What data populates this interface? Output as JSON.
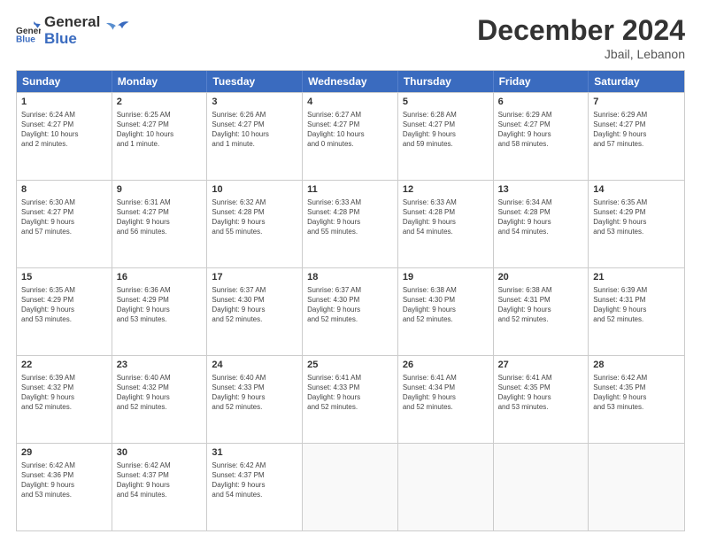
{
  "app": {
    "logo_line1": "General",
    "logo_line2": "Blue",
    "month": "December 2024",
    "location": "Jbail, Lebanon"
  },
  "header_days": [
    "Sunday",
    "Monday",
    "Tuesday",
    "Wednesday",
    "Thursday",
    "Friday",
    "Saturday"
  ],
  "rows": [
    [
      {
        "day": "1",
        "text": "Sunrise: 6:24 AM\nSunset: 4:27 PM\nDaylight: 10 hours\nand 2 minutes."
      },
      {
        "day": "2",
        "text": "Sunrise: 6:25 AM\nSunset: 4:27 PM\nDaylight: 10 hours\nand 1 minute."
      },
      {
        "day": "3",
        "text": "Sunrise: 6:26 AM\nSunset: 4:27 PM\nDaylight: 10 hours\nand 1 minute."
      },
      {
        "day": "4",
        "text": "Sunrise: 6:27 AM\nSunset: 4:27 PM\nDaylight: 10 hours\nand 0 minutes."
      },
      {
        "day": "5",
        "text": "Sunrise: 6:28 AM\nSunset: 4:27 PM\nDaylight: 9 hours\nand 59 minutes."
      },
      {
        "day": "6",
        "text": "Sunrise: 6:29 AM\nSunset: 4:27 PM\nDaylight: 9 hours\nand 58 minutes."
      },
      {
        "day": "7",
        "text": "Sunrise: 6:29 AM\nSunset: 4:27 PM\nDaylight: 9 hours\nand 57 minutes."
      }
    ],
    [
      {
        "day": "8",
        "text": "Sunrise: 6:30 AM\nSunset: 4:27 PM\nDaylight: 9 hours\nand 57 minutes."
      },
      {
        "day": "9",
        "text": "Sunrise: 6:31 AM\nSunset: 4:27 PM\nDaylight: 9 hours\nand 56 minutes."
      },
      {
        "day": "10",
        "text": "Sunrise: 6:32 AM\nSunset: 4:28 PM\nDaylight: 9 hours\nand 55 minutes."
      },
      {
        "day": "11",
        "text": "Sunrise: 6:33 AM\nSunset: 4:28 PM\nDaylight: 9 hours\nand 55 minutes."
      },
      {
        "day": "12",
        "text": "Sunrise: 6:33 AM\nSunset: 4:28 PM\nDaylight: 9 hours\nand 54 minutes."
      },
      {
        "day": "13",
        "text": "Sunrise: 6:34 AM\nSunset: 4:28 PM\nDaylight: 9 hours\nand 54 minutes."
      },
      {
        "day": "14",
        "text": "Sunrise: 6:35 AM\nSunset: 4:29 PM\nDaylight: 9 hours\nand 53 minutes."
      }
    ],
    [
      {
        "day": "15",
        "text": "Sunrise: 6:35 AM\nSunset: 4:29 PM\nDaylight: 9 hours\nand 53 minutes."
      },
      {
        "day": "16",
        "text": "Sunrise: 6:36 AM\nSunset: 4:29 PM\nDaylight: 9 hours\nand 53 minutes."
      },
      {
        "day": "17",
        "text": "Sunrise: 6:37 AM\nSunset: 4:30 PM\nDaylight: 9 hours\nand 52 minutes."
      },
      {
        "day": "18",
        "text": "Sunrise: 6:37 AM\nSunset: 4:30 PM\nDaylight: 9 hours\nand 52 minutes."
      },
      {
        "day": "19",
        "text": "Sunrise: 6:38 AM\nSunset: 4:30 PM\nDaylight: 9 hours\nand 52 minutes."
      },
      {
        "day": "20",
        "text": "Sunrise: 6:38 AM\nSunset: 4:31 PM\nDaylight: 9 hours\nand 52 minutes."
      },
      {
        "day": "21",
        "text": "Sunrise: 6:39 AM\nSunset: 4:31 PM\nDaylight: 9 hours\nand 52 minutes."
      }
    ],
    [
      {
        "day": "22",
        "text": "Sunrise: 6:39 AM\nSunset: 4:32 PM\nDaylight: 9 hours\nand 52 minutes."
      },
      {
        "day": "23",
        "text": "Sunrise: 6:40 AM\nSunset: 4:32 PM\nDaylight: 9 hours\nand 52 minutes."
      },
      {
        "day": "24",
        "text": "Sunrise: 6:40 AM\nSunset: 4:33 PM\nDaylight: 9 hours\nand 52 minutes."
      },
      {
        "day": "25",
        "text": "Sunrise: 6:41 AM\nSunset: 4:33 PM\nDaylight: 9 hours\nand 52 minutes."
      },
      {
        "day": "26",
        "text": "Sunrise: 6:41 AM\nSunset: 4:34 PM\nDaylight: 9 hours\nand 52 minutes."
      },
      {
        "day": "27",
        "text": "Sunrise: 6:41 AM\nSunset: 4:35 PM\nDaylight: 9 hours\nand 53 minutes."
      },
      {
        "day": "28",
        "text": "Sunrise: 6:42 AM\nSunset: 4:35 PM\nDaylight: 9 hours\nand 53 minutes."
      }
    ],
    [
      {
        "day": "29",
        "text": "Sunrise: 6:42 AM\nSunset: 4:36 PM\nDaylight: 9 hours\nand 53 minutes."
      },
      {
        "day": "30",
        "text": "Sunrise: 6:42 AM\nSunset: 4:37 PM\nDaylight: 9 hours\nand 54 minutes."
      },
      {
        "day": "31",
        "text": "Sunrise: 6:42 AM\nSunset: 4:37 PM\nDaylight: 9 hours\nand 54 minutes."
      },
      {
        "day": "",
        "text": ""
      },
      {
        "day": "",
        "text": ""
      },
      {
        "day": "",
        "text": ""
      },
      {
        "day": "",
        "text": ""
      }
    ]
  ]
}
